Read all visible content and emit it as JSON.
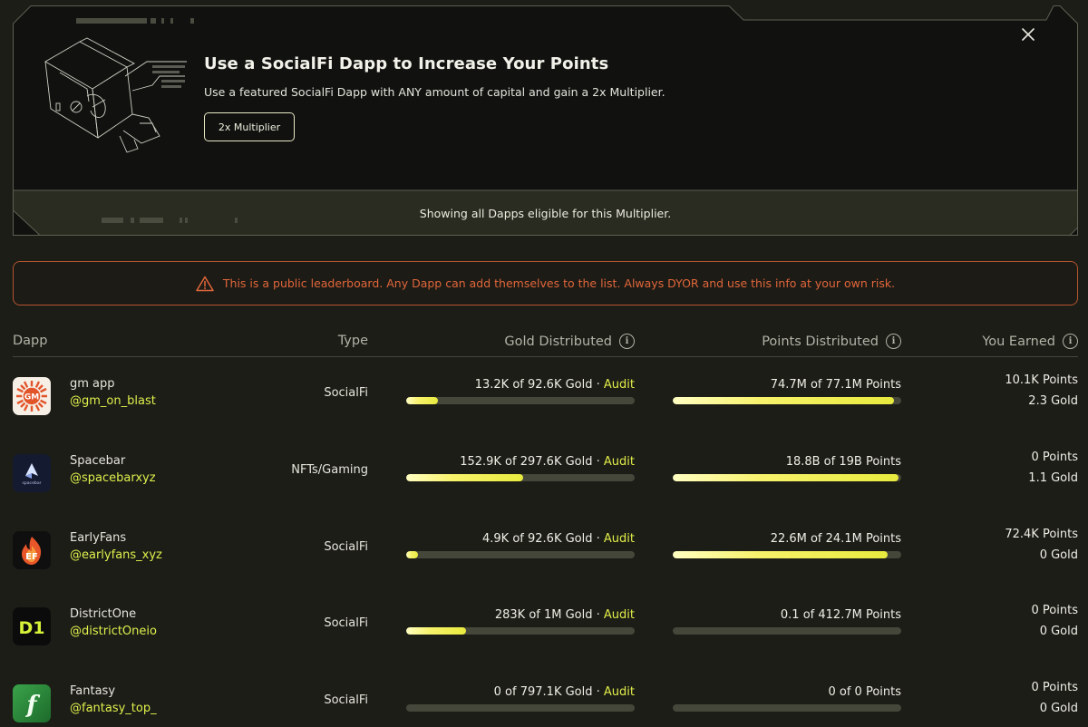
{
  "banner": {
    "title": "Use a SocialFi Dapp to Increase Your Points",
    "description": "Use a featured SocialFi Dapp with ANY amount of capital and gain a 2x Multiplier.",
    "button_label": "2x Multiplier",
    "showing_text": "Showing all Dapps eligible for this Multiplier."
  },
  "warning": {
    "text": "This is a public leaderboard. Any Dapp can add themselves to the list. Always DYOR and use this info at your own risk.",
    "color": "#e0663b"
  },
  "table": {
    "headers": {
      "dapp": "Dapp",
      "type": "Type",
      "gold": "Gold Distributed",
      "points": "Points Distributed",
      "earned": "You Earned"
    },
    "rows": [
      {
        "name": "gm app",
        "handle": "@gm_on_blast",
        "type": "SocialFi",
        "gold_text": "13.2K of 92.6K Gold",
        "audit": "Audit",
        "gold_fraction": 0.14,
        "points_text": "74.7M of 77.1M Points",
        "points_fraction": 0.97,
        "earned_points": "10.1K Points",
        "earned_gold": "2.3 Gold",
        "logo": "gm-logo",
        "logo_text": "GM"
      },
      {
        "name": "Spacebar",
        "handle": "@spacebarxyz",
        "type": "NFTs/Gaming",
        "gold_text": "152.9K of 297.6K Gold",
        "audit": "Audit",
        "gold_fraction": 0.51,
        "points_text": "18.8B of 19B Points",
        "points_fraction": 0.99,
        "earned_points": "0 Points",
        "earned_gold": "1.1 Gold",
        "logo": "spacebar-logo",
        "logo_text": "spacebar"
      },
      {
        "name": "EarlyFans",
        "handle": "@earlyfans_xyz",
        "type": "SocialFi",
        "gold_text": "4.9K of 92.6K Gold",
        "audit": "Audit",
        "gold_fraction": 0.05,
        "points_text": "22.6M of 24.1M Points",
        "points_fraction": 0.94,
        "earned_points": "72.4K Points",
        "earned_gold": "0 Gold",
        "logo": "earlyfans-logo",
        "logo_text": "EF"
      },
      {
        "name": "DistrictOne",
        "handle": "@districtOneio",
        "type": "SocialFi",
        "gold_text": "283K of 1M Gold",
        "audit": "Audit",
        "gold_fraction": 0.26,
        "points_text": "0.1 of 412.7M Points",
        "points_fraction": 0.0,
        "earned_points": "0 Points",
        "earned_gold": "0 Gold",
        "logo": "districtone-logo",
        "logo_text": "D1"
      },
      {
        "name": "Fantasy",
        "handle": "@fantasy_top_",
        "type": "SocialFi",
        "gold_text": "0 of 797.1K Gold",
        "audit": "Audit",
        "gold_fraction": 0.0,
        "points_text": "0 of 0 Points",
        "points_fraction": 0.0,
        "earned_points": "0 Points",
        "earned_gold": "0 Gold",
        "logo": "fantasy-logo",
        "logo_text": "f"
      }
    ]
  },
  "colors": {
    "accent": "#dff04c",
    "background": "#1c1d17",
    "bar_track": "#45473a"
  }
}
